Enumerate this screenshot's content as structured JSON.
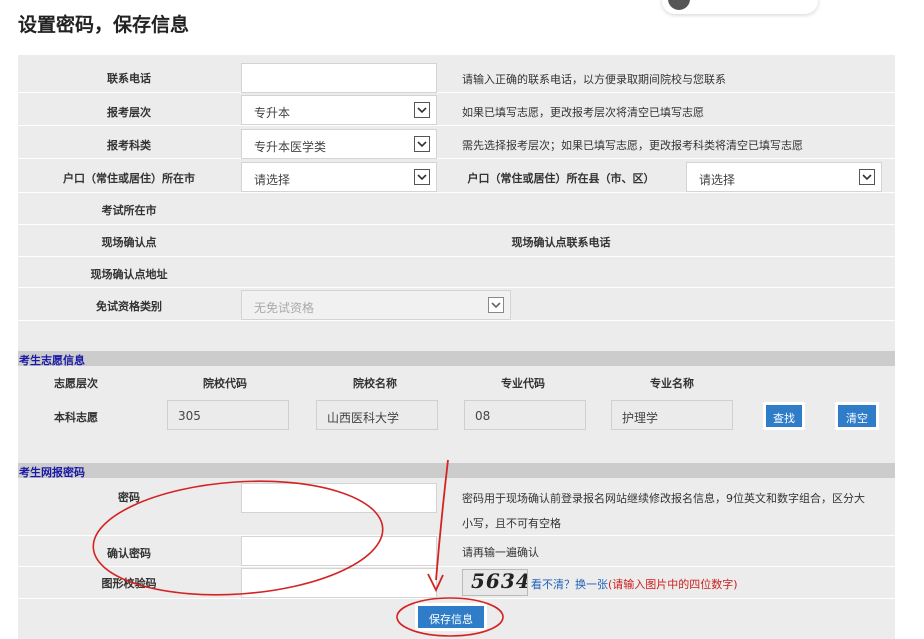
{
  "page_title": "设置密码，保存信息",
  "basic": {
    "phone_label": "联系电话",
    "phone_hint": "请输入正确的联系电话，以方便录取期间院校与您联系",
    "level_label": "报考层次",
    "level_value": "专升本",
    "level_hint": "如果已填写志愿，更改报考层次将清空已填写志愿",
    "subject_label": "报考科类",
    "subject_value": "专升本医学类",
    "subject_hint": "需先选择报考层次；如果已填写志愿，更改报考科类将清空已填写志愿",
    "city_label": "户口（常住或居住）所在市",
    "city_value": "请选择",
    "county_label": "户口（常住或居住）所在县（市、区）",
    "county_value": "请选择",
    "exam_loc_label": "考试所在市",
    "confirm_point_label": "现场确认点",
    "confirm_phone_label": "现场确认点联系电话",
    "confirm_addr_label": "现场确认点地址",
    "exempt_label": "免试资格类别",
    "exempt_value": "无免试资格"
  },
  "wish": {
    "section_title": "考生志愿信息",
    "headers": [
      "志愿层次",
      "院校代码",
      "院校名称",
      "专业代码",
      "专业名称"
    ],
    "row_label": "本科志愿",
    "school_code": "305",
    "school_name": "山西医科大学",
    "major_code": "08",
    "major_name": "护理学",
    "search_btn": "查找",
    "clear_btn": "清空"
  },
  "password": {
    "section_title": "考生网报密码",
    "pwd_label": "密码",
    "pwd_hint_1": "密码用于现场确认前登录报名网站继续修改报名信息，9位英文和数字组合，区分大",
    "pwd_hint_2": "小写，且不可有空格",
    "confirm_label": "确认密码",
    "confirm_hint": "请再输一遍确认",
    "captcha_label": "图形校验码",
    "captcha_text": "5634",
    "captcha_refresh": "看不清？换一张",
    "captcha_note": "(请输入图片中的四位数字)",
    "save_btn": "保存信息"
  },
  "colors": {
    "accent": "#2f7dc9",
    "section_text": "#1a1aa8",
    "annotation_red": "#d42323",
    "warning_red": "#cc1d1d"
  }
}
